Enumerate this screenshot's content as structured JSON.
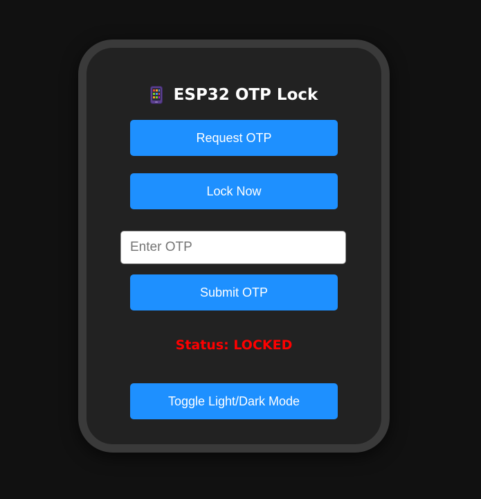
{
  "header": {
    "icon": "mobile-phone-icon",
    "title": "ESP32 OTP Lock"
  },
  "actions": {
    "request_otp_label": "Request OTP",
    "lock_now_label": "Lock Now",
    "submit_otp_label": "Submit OTP",
    "toggle_theme_label": "Toggle Light/Dark Mode"
  },
  "otp_field": {
    "placeholder": "Enter OTP",
    "value": ""
  },
  "status": {
    "text": "Status: LOCKED",
    "color": "#ff0000"
  },
  "colors": {
    "accent": "#1e90ff",
    "background": "#111111",
    "card": "#222222",
    "card_border": "#3a3a3a"
  }
}
